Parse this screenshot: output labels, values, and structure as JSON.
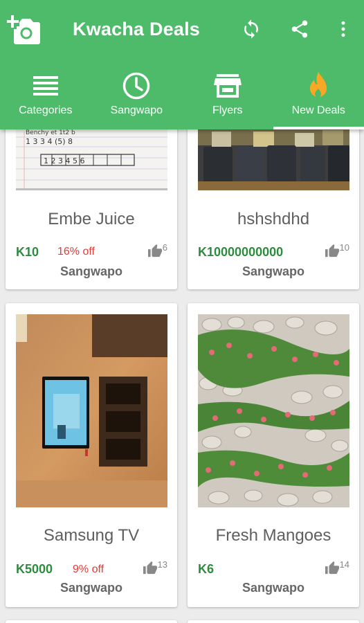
{
  "app": {
    "title": "Kwacha Deals"
  },
  "colors": {
    "primary": "#4dbb6a",
    "price": "#2e8b3e",
    "discount": "#e53935",
    "hot": "#f9a825"
  },
  "tabs": [
    {
      "label": "Categories",
      "icon": "list-icon"
    },
    {
      "label": "Sangwapo",
      "icon": "clock-icon"
    },
    {
      "label": "Flyers",
      "icon": "store-icon"
    },
    {
      "label": "New Deals",
      "icon": "flame-icon",
      "active": true
    }
  ],
  "deals": [
    {
      "name": "Embe Juice",
      "price": "K10",
      "discount": "16% off",
      "likes": "6",
      "store": "Sangwapo",
      "photo": "notebook-photo"
    },
    {
      "name": "hshshdhd",
      "price": "K10000000000",
      "discount": "",
      "likes": "10",
      "store": "Sangwapo",
      "photo": "dark-bags-photo"
    },
    {
      "name": "Samsung TV",
      "price": "K5000",
      "discount": "9% off",
      "likes": "13",
      "store": "Sangwapo",
      "photo": "tv-photo"
    },
    {
      "name": "Fresh Mangoes",
      "price": "K6",
      "discount": "",
      "likes": "14",
      "store": "Sangwapo",
      "photo": "flower-garden-photo"
    }
  ]
}
